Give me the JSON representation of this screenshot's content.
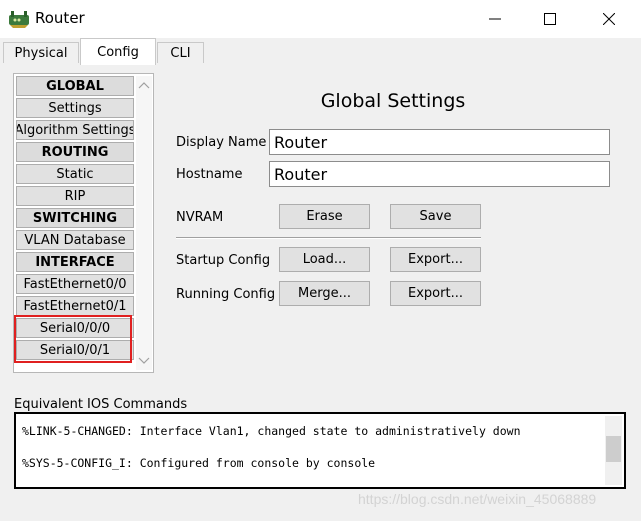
{
  "window": {
    "title": "Router"
  },
  "tabs": [
    {
      "label": "Physical"
    },
    {
      "label": "Config",
      "active": true
    },
    {
      "label": "CLI"
    }
  ],
  "sidebar": {
    "items": [
      {
        "label": "GLOBAL",
        "type": "header"
      },
      {
        "label": "Settings"
      },
      {
        "label": "Algorithm Settings"
      },
      {
        "label": "ROUTING",
        "type": "header"
      },
      {
        "label": "Static"
      },
      {
        "label": "RIP"
      },
      {
        "label": "SWITCHING",
        "type": "header"
      },
      {
        "label": "VLAN Database"
      },
      {
        "label": "INTERFACE",
        "type": "header"
      },
      {
        "label": "FastEthernet0/0"
      },
      {
        "label": "FastEthernet0/1"
      },
      {
        "label": "Serial0/0/0"
      },
      {
        "label": "Serial0/0/1"
      }
    ]
  },
  "main": {
    "title": "Global Settings",
    "display_name": {
      "label": "Display Name",
      "value": "Router"
    },
    "hostname": {
      "label": "Hostname",
      "value": "Router"
    },
    "nvram": {
      "label": "NVRAM",
      "erase": "Erase",
      "save": "Save"
    },
    "startup": {
      "label": "Startup Config",
      "load": "Load...",
      "export": "Export..."
    },
    "running": {
      "label": "Running Config",
      "merge": "Merge...",
      "export": "Export..."
    }
  },
  "ios": {
    "label": "Equivalent IOS Commands",
    "lines": [
      "%LINK-5-CHANGED: Interface Vlan1, changed state to administratively down",
      "%SYS-5-CONFIG_I: Configured from console by console"
    ]
  },
  "watermark": "https://blog.csdn.net/weixin_45068889",
  "colors": {
    "highlight": "#e02020"
  },
  "icons": {
    "app": "router-icon",
    "minimize": "minimize-icon",
    "maximize": "maximize-icon",
    "close": "close-icon"
  }
}
